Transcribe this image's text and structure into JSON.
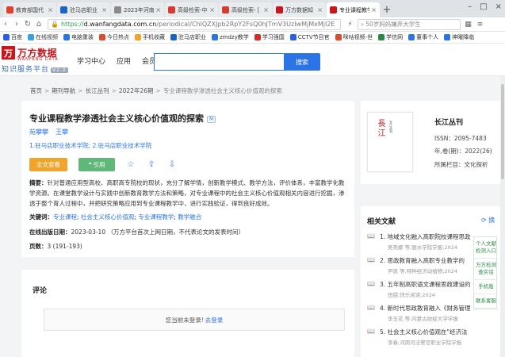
{
  "browser": {
    "tabs": [
      {
        "label": "教育部国代",
        "color": "#e0402f"
      },
      {
        "label": "驻马店职业",
        "color": "#1d62c8"
      },
      {
        "label": "2023年河南",
        "color": "#8a8a8a"
      },
      {
        "label": "高级检索-中",
        "color": "#d83a2e"
      },
      {
        "label": "高级检索- [",
        "color": "#d83a2e"
      },
      {
        "label": "万方数据知",
        "color": "#c8161d"
      },
      {
        "label": "专业课程教学",
        "color": "#c8161d"
      }
    ],
    "url_scheme": "https://",
    "url_host": "d.wanfangdata.com.cn",
    "url_path": "/periodical/ChlQZXJpb2RpY2FsQ0hJTmV3UzIwMjMxMjI2E",
    "side_search": "50岁妈妈嫌弃大学生",
    "bookmarks": [
      {
        "label": "百度",
        "color": "#2b5de6"
      },
      {
        "label": "在线视频",
        "color": "#3aa0e6"
      },
      {
        "label": "电脑重装",
        "color": "#2b74e6"
      },
      {
        "label": "今日热点",
        "color": "#e04a2e"
      },
      {
        "label": "手机收藏",
        "color": "#f0a42b"
      },
      {
        "label": "驻马店职业",
        "color": "#1d62c8"
      },
      {
        "label": "zmdzy教学",
        "color": "#2b74e6"
      },
      {
        "label": "学习强国",
        "color": "#d92b2b"
      },
      {
        "label": "CCTV节目官",
        "color": "#2b5de6"
      },
      {
        "label": "咪咕视频-世",
        "color": "#e04a2e"
      },
      {
        "label": "学信网",
        "color": "#2a8a44"
      },
      {
        "label": "董事个人",
        "color": "#2b74e6"
      },
      {
        "label": "神曜降临",
        "color": "#2b74e6"
      }
    ]
  },
  "site": {
    "logo_cn": "万方数据",
    "logo_en": "WANFANG DATA",
    "logo_sub": "知识服务平台",
    "logo_ver": "V2.0",
    "nav": [
      "学习中心",
      "应用",
      "会员"
    ],
    "search_button": "搜索"
  },
  "breadcrumb": [
    "首页",
    "期刊导航",
    "长江丛刊",
    "2022年26期",
    "专业课程教学渗透社会主义核心价值观的探索"
  ],
  "article": {
    "title": "专业课程教学渗透社会主义核心价值观的探索",
    "badge": "M",
    "authors": [
      "苑攀攀",
      "王攀"
    ],
    "affiliation": "1.驻马店职业技术学院; 2.驻马店职业技术学院",
    "btn_full": "全文查看",
    "btn_cite": "引用",
    "abstract_label": "摘要：",
    "abstract": "针对普通应用型高校、高职高专院校的现状，充分了解学情，创新教学模式、教学方法，评价体系，丰富教学化教学资源。在课堂教学设计与实践中创新教育教学方法和策略，对专业课程中的社会主义核心价值观相关内容进行挖掘，渗透于整个育人过程中，并把研究策略应用到专业课程教学中，进行实践验证，得到良好成效。",
    "kw_label": "关键词：",
    "keywords": [
      "专业课程",
      "社会主义核心价值观",
      "专业课程教学",
      "教学融合"
    ],
    "pubdate_label": "在线出版日期：",
    "pubdate": "2023-03-10 （万方平台首次上网日期，不代表论文的发表时间）",
    "pages_label": "页数：",
    "pages": "3 (191-193)"
  },
  "comments": {
    "title": "评论",
    "notice": "您当前未登录!",
    "login": "去登录"
  },
  "journal": {
    "cover_title": "長江",
    "name": "长江丛刊",
    "issn": "ISSN：2095-7483",
    "issue": "年,卷(期)：2022(26)",
    "column": "所属栏目：文化探析"
  },
  "related": {
    "title": "相关文献",
    "refresh": "换",
    "items": [
      {
        "num": "1.",
        "title": "地域文化融入高职院校课程思政",
        "meta": "吴美娜 等;丽水学院学报;2024"
      },
      {
        "num": "2.",
        "title": "思政教育融入高职专业教学的",
        "meta": "尹恩 等;特种经济动植物;2024"
      },
      {
        "num": "3.",
        "title": "五年制高职语文课程思政建设的",
        "meta": "田甜;快乐阅读;2024"
      },
      {
        "num": "4.",
        "title": "新时代思政教育融入《财务管理",
        "meta": "李玉花 等;内蒙古财经大学学报"
      },
      {
        "num": "5.",
        "title": "社会主义核心价值观在\"经济法",
        "meta": "李春;河南司法警官职业学院学报"
      }
    ]
  },
  "float": [
    "个人文献检测入口",
    "万方检测查实话",
    "手机版",
    "联系客服"
  ]
}
